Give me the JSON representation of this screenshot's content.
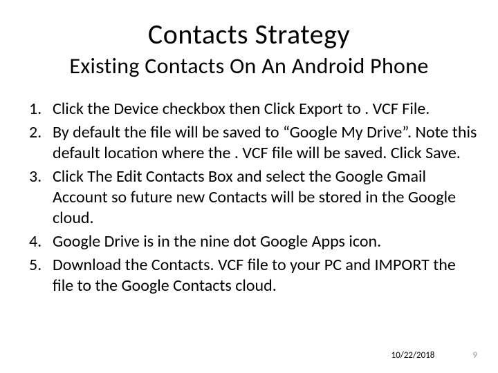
{
  "title": "Contacts Strategy",
  "subtitle": "Existing Contacts On An Android Phone",
  "items": [
    "Click the Device checkbox then Click Export to . VCF File.",
    "By default the file will be saved to “Google My Drive”. Note this default location where the . VCF file will be saved.  Click Save.",
    "Click The Edit Contacts Box and select the Google  Gmail Account so future new Contacts will be stored in the Google cloud.",
    "Google Drive is in the nine dot Google Apps icon.",
    "Download the Contacts. VCF file to your PC and IMPORT the file to the Google Contacts cloud."
  ],
  "footer": {
    "date": "10/22/2018",
    "page": "9"
  }
}
